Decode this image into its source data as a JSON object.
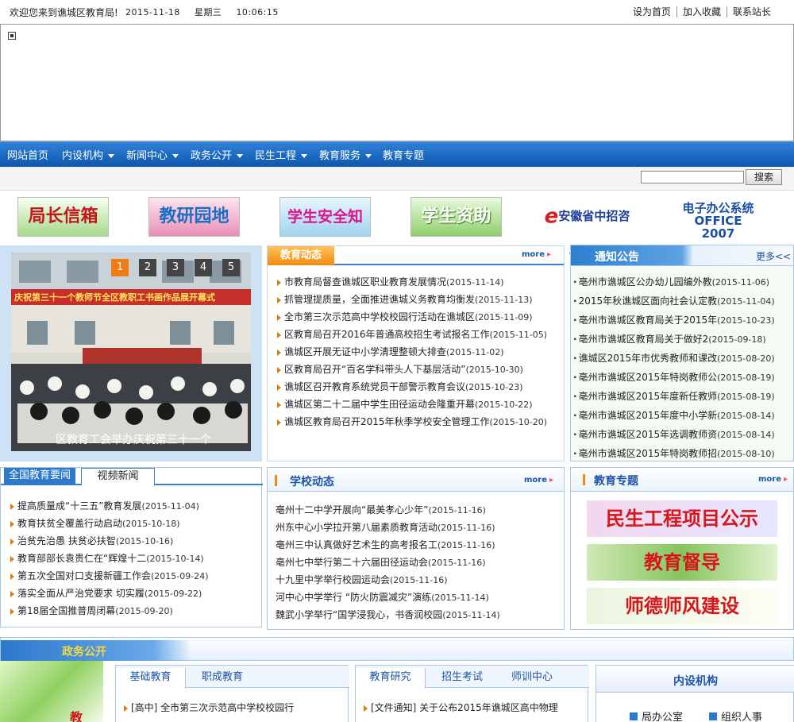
{
  "topbar": {
    "welcome": "欢迎您来到谯城区教育局!",
    "date": "2015-11-18",
    "weekday": "星期三",
    "time": "10:06:15",
    "links": [
      "设为首页",
      "加入收藏",
      "联系站长"
    ]
  },
  "nav": {
    "items": [
      {
        "label": "网站首页",
        "dropdown": false
      },
      {
        "label": "内设机构",
        "dropdown": true
      },
      {
        "label": "新闻中心",
        "dropdown": true
      },
      {
        "label": "政务公开",
        "dropdown": true
      },
      {
        "label": "民生工程",
        "dropdown": true
      },
      {
        "label": "教育服务",
        "dropdown": true
      },
      {
        "label": "教育专题",
        "dropdown": false
      }
    ]
  },
  "search": {
    "button": "搜索",
    "value": ""
  },
  "quick_banners": [
    "局长信箱",
    "教研园地",
    "学生安全知识",
    "学生资助",
    "安徽省中招咨询平台",
    "电子办公系统",
    "OFFICE 2007"
  ],
  "slideshow": {
    "pages": [
      "1",
      "2",
      "3",
      "4",
      "5"
    ],
    "active_page": 1,
    "banner_text": "庆祝第三十一个教师节全区教职工书画作品展开幕式",
    "caption": "区教育工会举办庆祝第三十一个"
  },
  "education_news": {
    "title": "教育动态",
    "more": "more",
    "items": [
      {
        "text": "市教育局督查谯城区职业教育发展情况",
        "date": "(2015-11-14)"
      },
      {
        "text": "抓管理提质量，全面推进谯城义务教育均衡发",
        "date": "(2015-11-13)"
      },
      {
        "text": "全市第三次示范高中学校校园行活动在谯城区",
        "date": "(2015-11-09)"
      },
      {
        "text": "区教育局召开2016年普通高校招生考试报名工作",
        "date": "(2015-11-05)"
      },
      {
        "text": "谯城区开展无证中小学清理整顿大排查",
        "date": "(2015-11-02)"
      },
      {
        "text": "区教育局召开“百名学科带头人下基层活动”",
        "date": "(2015-10-30)"
      },
      {
        "text": "谯城区召开教育系统党员干部警示教育会议",
        "date": "(2015-10-23)"
      },
      {
        "text": "谯城区第二十二届中学生田径运动会隆重开幕",
        "date": "(2015-10-22)"
      },
      {
        "text": "谯城区教育局召开2015年秋季学校安全管理工作",
        "date": "(2015-10-20)"
      }
    ]
  },
  "notices": {
    "title": "通知公告",
    "more": "更多<<",
    "items": [
      {
        "text": "亳州市谯城区公办幼儿园编外教",
        "date": "(2015-11-06)"
      },
      {
        "text": "2015年秋谯城区面向社会认定教",
        "date": "(2015-11-04)"
      },
      {
        "text": "亳州市谯城区教育局关于2015年",
        "date": "(2015-10-23)"
      },
      {
        "text": "亳州市谯城区教育局关于做好2",
        "date": "(2015-09-18)"
      },
      {
        "text": "谯城区2015年市优秀教师和课改",
        "date": "(2015-08-20)"
      },
      {
        "text": "亳州市谯城区2015年特岗教师公",
        "date": "(2015-08-19)"
      },
      {
        "text": "亳州市谯城区2015年度新任教师",
        "date": "(2015-08-19)"
      },
      {
        "text": "亳州市谯城区2015年度中小学新",
        "date": "(2015-08-14)"
      },
      {
        "text": "亳州市谯城区2015年选调教师资",
        "date": "(2015-08-14)"
      },
      {
        "text": "亳州市谯城区2015年特岗教师招",
        "date": "(2015-08-10)"
      }
    ]
  },
  "national_news": {
    "tabs": [
      "全国教育要闻",
      "视频新闻"
    ],
    "items": [
      {
        "text": "提高质量成“十三五”教育发展",
        "date": "(2015-11-04)"
      },
      {
        "text": "教育扶贫全覆盖行动启动",
        "date": "(2015-10-18)"
      },
      {
        "text": "治贫先治愚 扶贫必扶智",
        "date": "(2015-10-16)"
      },
      {
        "text": "教育部部长袁贵仁在“辉煌十二",
        "date": "(2015-10-14)"
      },
      {
        "text": "第五次全国对口支援新疆工作会",
        "date": "(2015-09-24)"
      },
      {
        "text": "落实全面从严治党要求 切实履",
        "date": "(2015-09-22)"
      },
      {
        "text": "第18届全国推普周闭幕",
        "date": "(2015-09-20)"
      }
    ]
  },
  "school_news": {
    "title": "学校动态",
    "more": "more",
    "items": [
      {
        "text": "亳州十二中学开展向“最美孝心少年”",
        "date": "(2015-11-16)"
      },
      {
        "text": "州东中心小学拉开第八届素质教育活动",
        "date": "(2015-11-16)"
      },
      {
        "text": "亳州三中认真做好艺术生的高考报名工",
        "date": "(2015-11-16)"
      },
      {
        "text": "亳州七中举行第二十六届田径运动会",
        "date": "(2015-11-16)"
      },
      {
        "text": "十九里中学举行校园运动会",
        "date": "(2015-11-16)"
      },
      {
        "text": "河中心中学举行 “防火防震减灾”演练",
        "date": "(2015-11-14)"
      },
      {
        "text": "魏武小学举行“国学浸我心，书香润校园",
        "date": "(2015-11-14)"
      }
    ]
  },
  "special_topics": {
    "title": "教育专题",
    "more": "more",
    "banners": [
      "民生工程项目公示",
      "教育督导",
      "师德师风建设"
    ]
  },
  "gov_open": {
    "title": "政务公开",
    "side_char": "教",
    "tabs_left": [
      "基础教育",
      "职成教育"
    ],
    "left_items": [
      "[高中] 全市第三次示范高中学校校园行"
    ],
    "tabs_mid": [
      "教育研究",
      "招生考试",
      "师训中心"
    ],
    "mid_items": [
      "[文件通知] 关于公布2015年谯城区高中物理"
    ],
    "org_title": "内设机构",
    "org_items": [
      "局办公室",
      "组织人事"
    ]
  }
}
